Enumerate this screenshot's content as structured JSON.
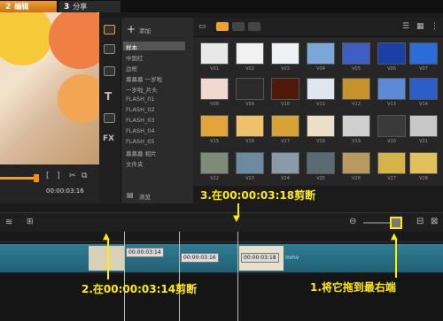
{
  "tabs": [
    {
      "num": "2",
      "label": "编辑"
    },
    {
      "num": "3",
      "label": "分享"
    }
  ],
  "preview": {
    "timecode": "00:00:03:16"
  },
  "library": {
    "add_label": "添加",
    "browse_label": "浏览",
    "categories": [
      "样本",
      "中国红",
      "边框",
      "幕幕墓 一岁啦",
      "一岁啦_片头",
      "FLASH_01",
      "FLASH_02",
      "FLASH_03",
      "FLASH_04",
      "FLASH_05",
      "幕幕墓 相片",
      "文件夹"
    ]
  },
  "thumbs": {
    "labels": [
      "V01",
      "V02",
      "V03",
      "V04",
      "V05",
      "V06",
      "V07",
      "V08",
      "V09",
      "V10",
      "V11",
      "V12",
      "V13",
      "V14",
      "V15",
      "V16",
      "V17",
      "V18",
      "V19",
      "V20",
      "V21",
      "V22",
      "V23",
      "V24",
      "V25",
      "V26",
      "V27",
      "V28"
    ]
  },
  "timeline": {
    "tc1": "00:00:03:14",
    "tc2": "00:00:03:16",
    "tc3": "00:00:03:18",
    "clip_label": "mmv"
  },
  "annotations": {
    "a1": "1.将它拖到最右端",
    "a2": "2.在00:00:03:14剪断",
    "a3": "3.在00:00:03:18剪断"
  },
  "colors": {
    "accent": "#f0a030",
    "annotation": "#ffec00",
    "track": "#2e7d94"
  }
}
